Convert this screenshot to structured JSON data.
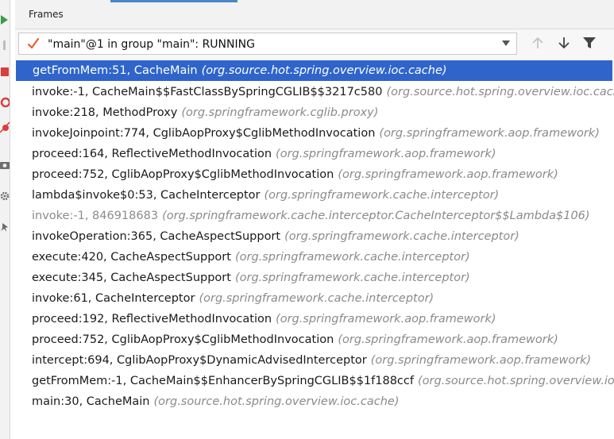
{
  "panel": {
    "title": "Frames"
  },
  "thread_selector": {
    "value": "\"main\"@1 in group \"main\": RUNNING"
  },
  "colors": {
    "selected_row": "#2f65ca",
    "package_text": "#8a8a8a",
    "check": "#e8612c",
    "accent": "#4a86c8"
  },
  "icons": [
    "resume-icon",
    "stop-icon",
    "breakpoint-icon",
    "mute-breakpoints-icon",
    "camera-icon",
    "settings-icon",
    "pin-icon",
    "check-icon",
    "chevron-down-icon",
    "arrow-up-icon",
    "arrow-down-icon",
    "filter-icon"
  ],
  "frames": [
    {
      "name": "getFromMem:51, CacheMain",
      "pkg": "(org.source.hot.spring.overview.ioc.cache)"
    },
    {
      "name": "invoke:-1, CacheMain$$FastClassBySpringCGLIB$$3217c580",
      "pkg": "(org.source.hot.spring.overview.ioc.cache)"
    },
    {
      "name": "invoke:218, MethodProxy",
      "pkg": "(org.springframework.cglib.proxy)"
    },
    {
      "name": "invokeJoinpoint:774, CglibAopProxy$CglibMethodInvocation",
      "pkg": "(org.springframework.aop.framework)"
    },
    {
      "name": "proceed:164, ReflectiveMethodInvocation",
      "pkg": "(org.springframework.aop.framework)"
    },
    {
      "name": "proceed:752, CglibAopProxy$CglibMethodInvocation",
      "pkg": "(org.springframework.aop.framework)"
    },
    {
      "name": "lambda$invoke$0:53, CacheInterceptor",
      "pkg": "(org.springframework.cache.interceptor)"
    },
    {
      "name": "invoke:-1, 846918683",
      "pkg": "(org.springframework.cache.interceptor.CacheInterceptor$$Lambda$106)"
    },
    {
      "name": "invokeOperation:365, CacheAspectSupport",
      "pkg": "(org.springframework.cache.interceptor)"
    },
    {
      "name": "execute:420, CacheAspectSupport",
      "pkg": "(org.springframework.cache.interceptor)"
    },
    {
      "name": "execute:345, CacheAspectSupport",
      "pkg": "(org.springframework.cache.interceptor)"
    },
    {
      "name": "invoke:61, CacheInterceptor",
      "pkg": "(org.springframework.cache.interceptor)"
    },
    {
      "name": "proceed:192, ReflectiveMethodInvocation",
      "pkg": "(org.springframework.aop.framework)"
    },
    {
      "name": "proceed:752, CglibAopProxy$CglibMethodInvocation",
      "pkg": "(org.springframework.aop.framework)"
    },
    {
      "name": "intercept:694, CglibAopProxy$DynamicAdvisedInterceptor",
      "pkg": "(org.springframework.aop.framework)"
    },
    {
      "name": "getFromMem:-1, CacheMain$$EnhancerBySpringCGLIB$$1f188ccf",
      "pkg": "(org.source.hot.spring.overview.ioc.cache)"
    },
    {
      "name": "main:30, CacheMain",
      "pkg": "(org.source.hot.spring.overview.ioc.cache)"
    }
  ]
}
